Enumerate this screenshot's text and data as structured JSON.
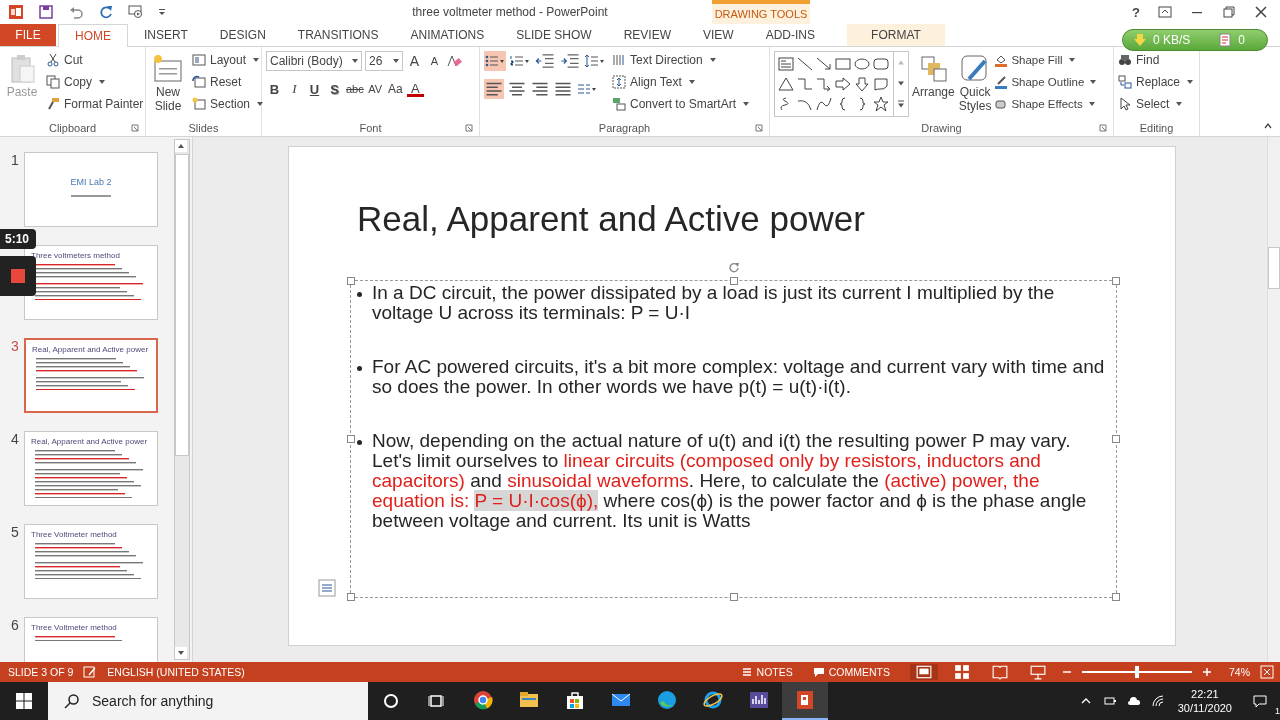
{
  "window": {
    "title": "three voltmeter method - PowerPoint",
    "context_label": "DRAWING TOOLS",
    "help": "?"
  },
  "tabs": [
    {
      "label": "FILE",
      "kind": "file",
      "selected": false
    },
    {
      "label": "HOME",
      "kind": "tab",
      "selected": true
    },
    {
      "label": "INSERT",
      "kind": "tab",
      "selected": false
    },
    {
      "label": "DESIGN",
      "kind": "tab",
      "selected": false
    },
    {
      "label": "TRANSITIONS",
      "kind": "tab",
      "selected": false
    },
    {
      "label": "ANIMATIONS",
      "kind": "tab",
      "selected": false
    },
    {
      "label": "SLIDE SHOW",
      "kind": "tab",
      "selected": false
    },
    {
      "label": "REVIEW",
      "kind": "tab",
      "selected": false
    },
    {
      "label": "VIEW",
      "kind": "tab",
      "selected": false
    },
    {
      "label": "ADD-INS",
      "kind": "tab",
      "selected": false
    },
    {
      "label": "FORMAT",
      "kind": "context",
      "selected": false
    }
  ],
  "transfer_widget": {
    "speed": "0 KB/S",
    "count": "0"
  },
  "ribbon": {
    "clipboard": {
      "label": "Clipboard",
      "paste": {
        "label": "Paste",
        "disabled": true
      },
      "cut": "Cut",
      "copy": "Copy",
      "format_painter": "Format Painter"
    },
    "slides": {
      "label": "Slides",
      "new_slide": [
        "New",
        "Slide"
      ],
      "layout": "Layout",
      "reset": "Reset",
      "section": "Section"
    },
    "font": {
      "label": "Font",
      "face": "Calibri (Body)",
      "size": "26",
      "grow": "A",
      "shrink": "A",
      "styles": [
        {
          "label": "B",
          "kind": "bold"
        },
        {
          "label": "I",
          "kind": "italic"
        },
        {
          "label": "U",
          "kind": "underline"
        },
        {
          "label": "S",
          "kind": "shadow"
        },
        {
          "label": "abc",
          "kind": "strike"
        },
        {
          "label": "AV",
          "kind": "spacing"
        },
        {
          "label": "Aa",
          "kind": "case"
        },
        {
          "label": "A",
          "kind": "color"
        }
      ]
    },
    "paragraph": {
      "label": "Paragraph",
      "bullets": {
        "selected": true
      },
      "alignments": [
        {
          "kind": "left",
          "selected": true
        },
        {
          "kind": "center",
          "selected": false
        },
        {
          "kind": "right",
          "selected": false
        },
        {
          "kind": "justify",
          "selected": false
        }
      ],
      "text_direction": "Text Direction",
      "align_text": "Align Text",
      "smartart": "Convert to SmartArt"
    },
    "drawing": {
      "label": "Drawing",
      "arrange": "Arrange",
      "quick_styles": [
        "Quick",
        "Styles"
      ],
      "shape_fill": "Shape Fill",
      "shape_outline": "Shape Outline",
      "shape_effects": "Shape Effects"
    },
    "editing": {
      "label": "Editing",
      "find": "Find",
      "replace": "Replace",
      "select": "Select"
    }
  },
  "thumbnails": [
    {
      "number": "1",
      "title": "EMI Lab 2",
      "kind": "title",
      "selected": false
    },
    {
      "title": "Three voltmeters method",
      "kind": "content",
      "selected": false
    },
    {
      "number": "3",
      "title": "Real, Apparent and Active power",
      "kind": "content",
      "selected": true
    },
    {
      "number": "4",
      "title": "Real, Apparent and Active power",
      "kind": "content",
      "selected": false
    },
    {
      "number": "5",
      "title": "Three Voltmeter method",
      "kind": "content",
      "selected": false
    },
    {
      "number": "6",
      "title": "Three Voltmeter method",
      "kind": "content",
      "selected": false
    }
  ],
  "recorder": {
    "time": "5:10"
  },
  "slide": {
    "title": "Real, Apparent and Active power",
    "bullets": [
      {
        "segments": [
          {
            "text": "In a DC circuit, the power dissipated by a load is just its current I multiplied by the voltage U across its terminals: P = U·I",
            "emphasis": false,
            "highlighted": false
          }
        ]
      },
      {
        "segments": [
          {
            "text": "For AC powered circuits, it's a bit more complex: voltage and current vary with time and so does the power. In other words we have p(t) = u(t)·i(t).",
            "emphasis": false,
            "highlighted": false
          }
        ]
      },
      {
        "segments": [
          {
            "text": "Now, depending on the actual nature of u(t) and i(t) the resulting power P may vary. Let's limit ourselves to ",
            "emphasis": false,
            "highlighted": false
          },
          {
            "text": "linear circuits (composed only by resistors, inductors and capacitors)",
            "emphasis": true,
            "highlighted": false
          },
          {
            "text": " and ",
            "emphasis": false,
            "highlighted": false
          },
          {
            "text": "sinusoidal waveforms",
            "emphasis": true,
            "highlighted": false
          },
          {
            "text": ". Here, to calculate the ",
            "emphasis": false,
            "highlighted": false
          },
          {
            "text": "(active) power, the equation is: ",
            "emphasis": true,
            "highlighted": false
          },
          {
            "text": "P = U·I·cos(ϕ),",
            "emphasis": true,
            "highlighted": true
          },
          {
            "text": " where cos(ϕ) is the power factor and ϕ is the phase angle between voltage and current. Its unit is Watts",
            "emphasis": false,
            "highlighted": false
          }
        ]
      }
    ]
  },
  "status_bar": {
    "slide": "SLIDE 3 OF 9",
    "language": "ENGLISH (UNITED STATES)",
    "notes": "NOTES",
    "comments": "COMMENTS",
    "zoom": {
      "level": 0.5
    },
    "zoom_reading": "74%"
  },
  "taskbar": {
    "search_placeholder": "Search for anything",
    "time": "22:21",
    "date": "30/11/2020",
    "notifications": "1",
    "apps": [
      {
        "kind": "chrome",
        "active": false
      },
      {
        "kind": "explorer",
        "active": false
      },
      {
        "kind": "store",
        "active": false
      },
      {
        "kind": "mail",
        "active": false
      },
      {
        "kind": "edge",
        "active": false
      },
      {
        "kind": "ie",
        "active": false
      },
      {
        "kind": "monitor",
        "active": false
      },
      {
        "kind": "powerpoint",
        "active": true
      }
    ]
  }
}
